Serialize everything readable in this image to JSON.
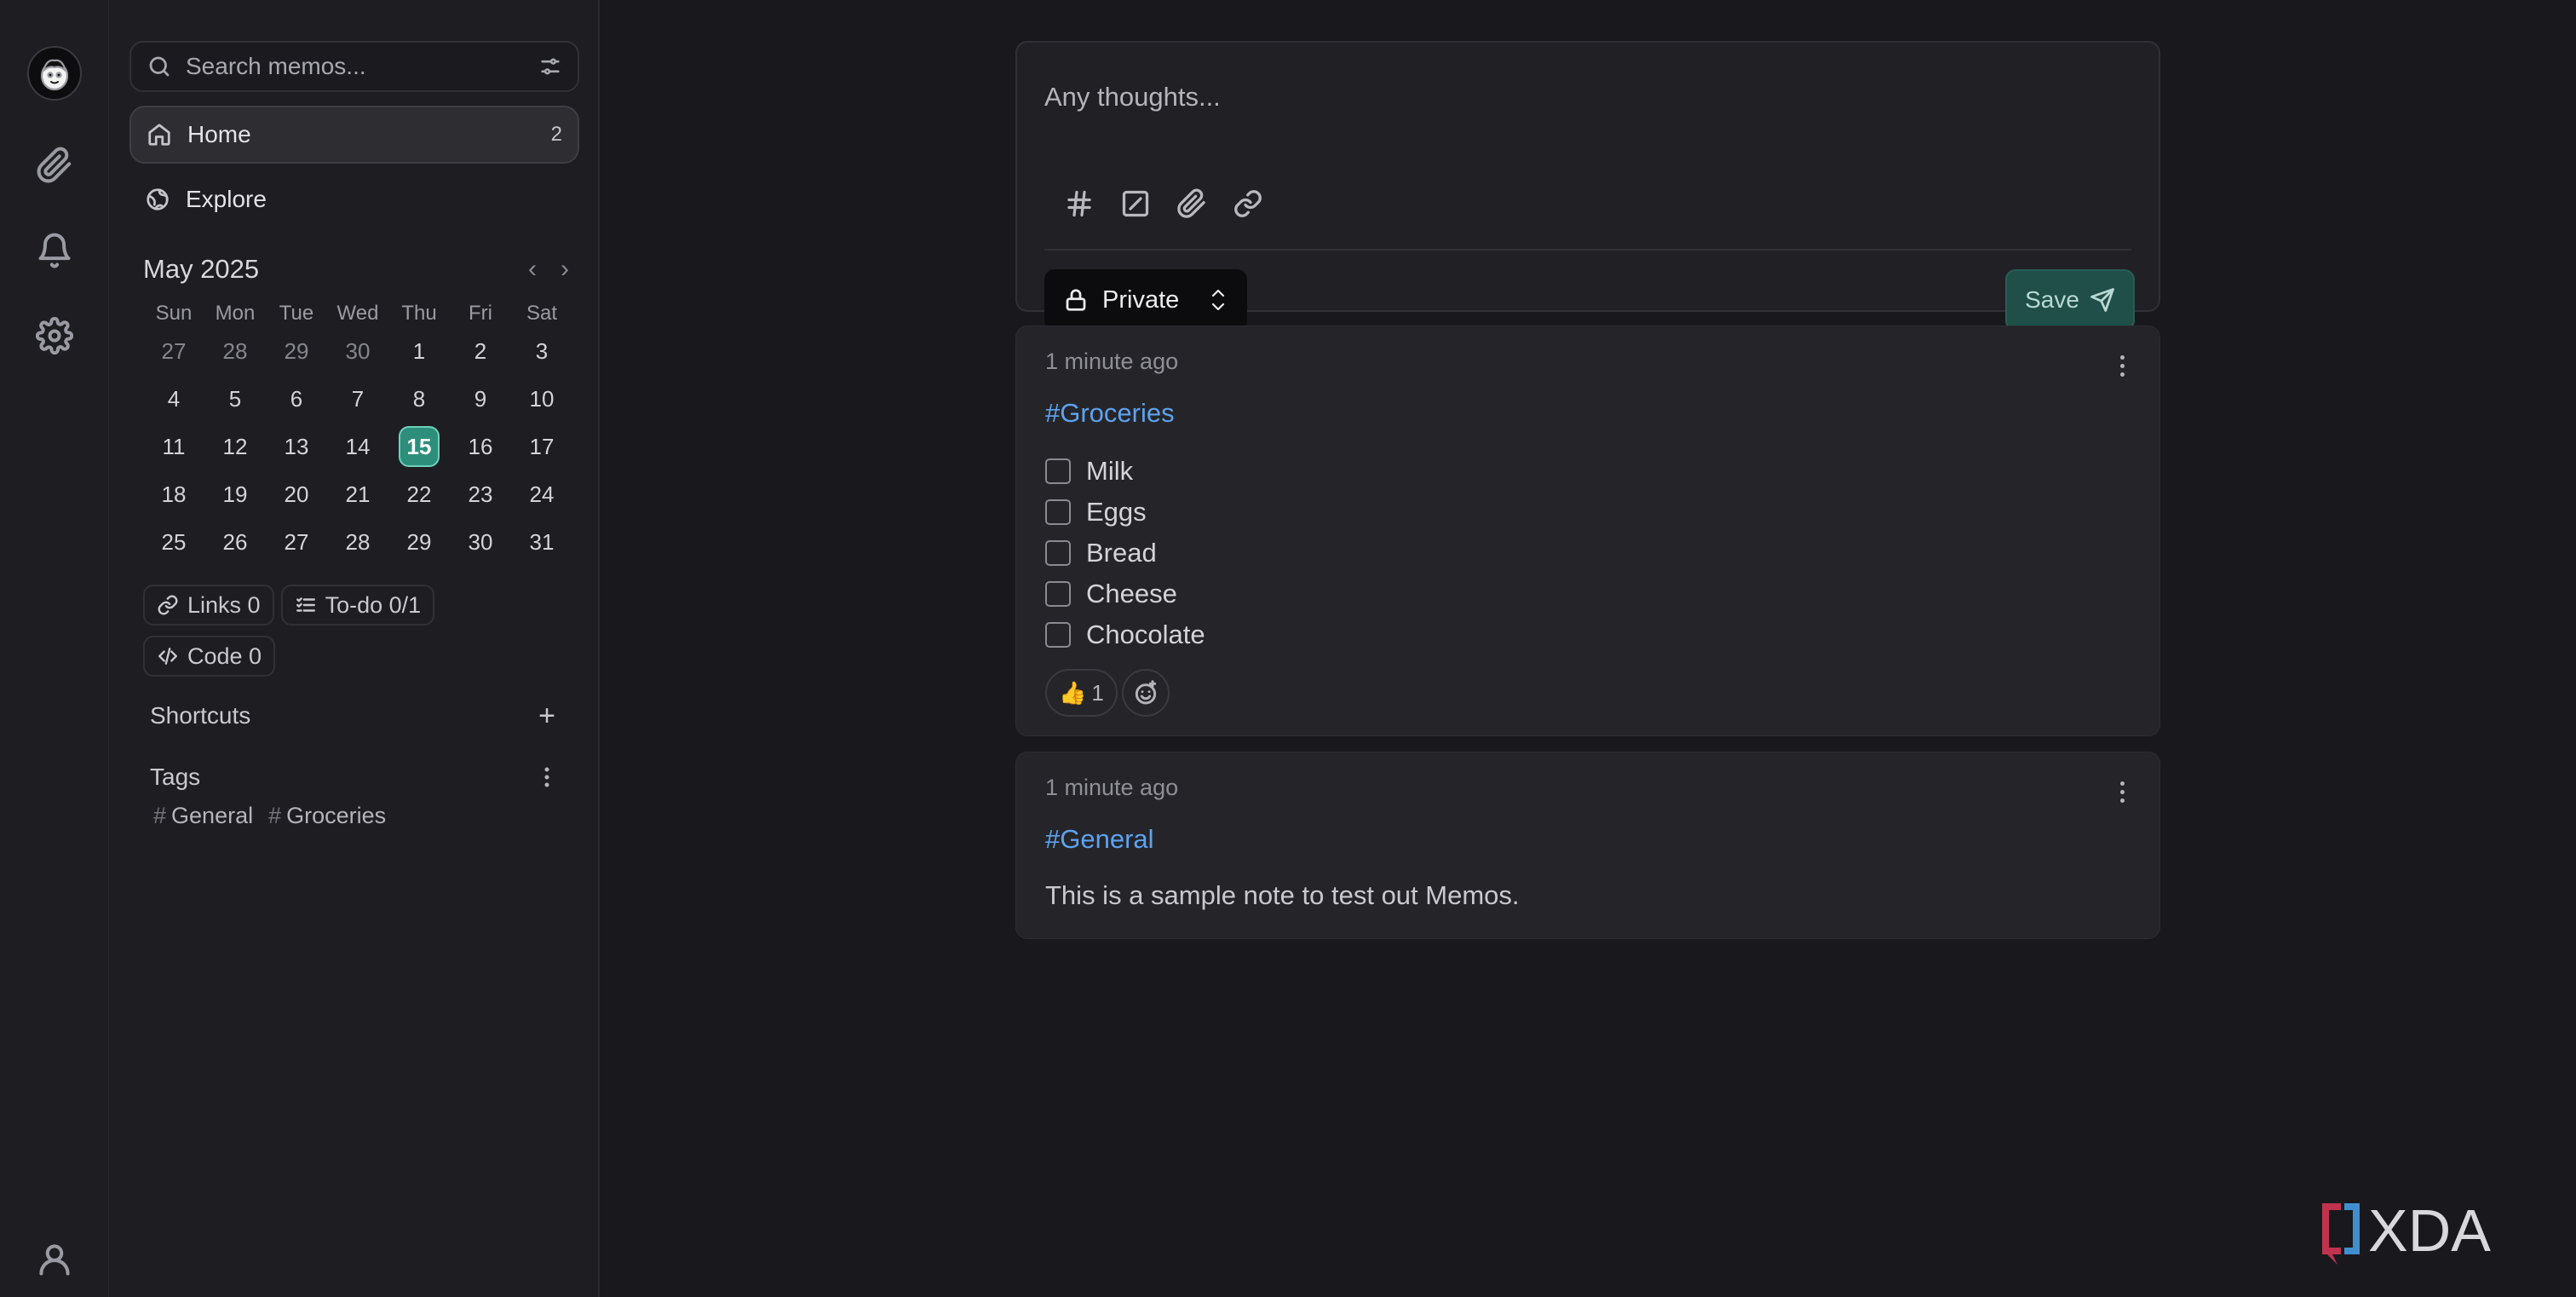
{
  "search": {
    "placeholder": "Search memos..."
  },
  "nav": {
    "home": {
      "label": "Home",
      "count": "2"
    },
    "explore": {
      "label": "Explore"
    }
  },
  "calendar": {
    "title": "May 2025",
    "prev": "‹",
    "next": "›",
    "weekdays": [
      "Sun",
      "Mon",
      "Tue",
      "Wed",
      "Thu",
      "Fri",
      "Sat"
    ],
    "weeks": [
      [
        "27",
        "28",
        "29",
        "30",
        "1",
        "2",
        "3"
      ],
      [
        "4",
        "5",
        "6",
        "7",
        "8",
        "9",
        "10"
      ],
      [
        "11",
        "12",
        "13",
        "14",
        "15",
        "16",
        "17"
      ],
      [
        "18",
        "19",
        "20",
        "21",
        "22",
        "23",
        "24"
      ],
      [
        "25",
        "26",
        "27",
        "28",
        "29",
        "30",
        "31"
      ]
    ],
    "today": "15"
  },
  "stats": {
    "links": "Links 0",
    "todo": "To-do 0/1",
    "code": "Code 0"
  },
  "shortcuts": {
    "title": "Shortcuts",
    "add": "+"
  },
  "tags": {
    "title": "Tags",
    "items": [
      "General",
      "Groceries"
    ],
    "hash": "#"
  },
  "editor": {
    "placeholder": "Any thoughts...",
    "visibility": "Private",
    "save_label": "Save"
  },
  "memos": [
    {
      "time": "1 minute ago",
      "tag": "#Groceries",
      "todos": [
        "Milk",
        "Eggs",
        "Bread",
        "Cheese",
        "Chocolate"
      ],
      "reaction": {
        "emoji": "👍",
        "count": "1"
      }
    },
    {
      "time": "1 minute ago",
      "tag": "#General",
      "body": "This is a sample note to test out Memos."
    }
  ],
  "watermark": "XDA",
  "colors": {
    "accent": "#2d8f7b",
    "tag_link": "#5ea2f0",
    "save_bg": "#1f4f48",
    "background": "#19191d",
    "sidebar": "#1e1e22"
  }
}
